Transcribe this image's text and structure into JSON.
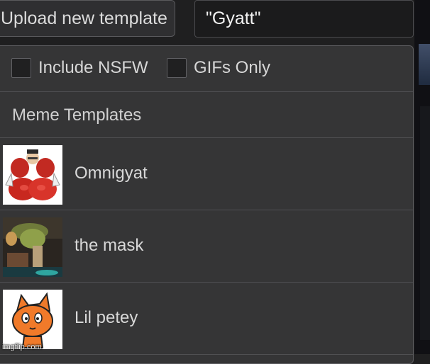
{
  "toolbar": {
    "upload_label": "Upload new template",
    "search_value": "\"Gyatt\""
  },
  "options": {
    "nsfw_label": "Include NSFW",
    "gifs_label": "GIFs Only"
  },
  "section": {
    "title": "Meme Templates"
  },
  "templates": [
    {
      "label": "Omnigyat"
    },
    {
      "label": "the mask"
    },
    {
      "label": "Lil petey"
    }
  ],
  "watermark": "imgflip.com",
  "colors": {
    "panel_bg": "#353536",
    "page_bg": "#1f1f20",
    "border": "#505053",
    "text": "#d8d8d8"
  }
}
